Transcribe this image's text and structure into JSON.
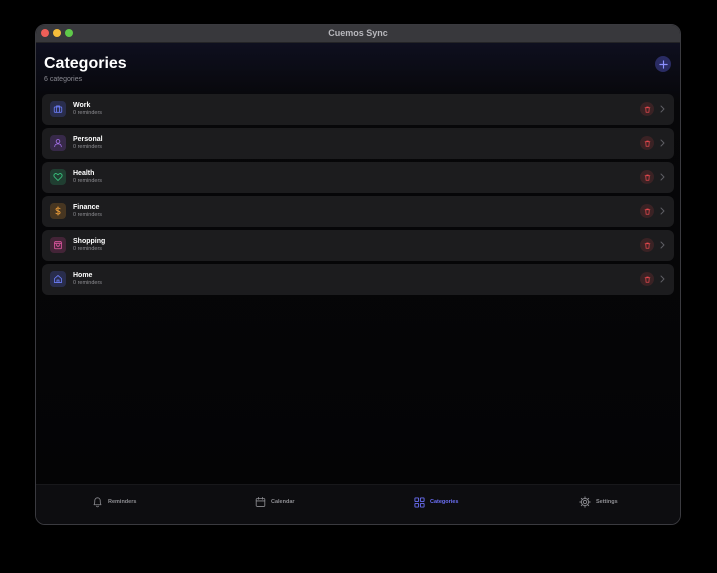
{
  "window": {
    "title": "Cuemos Sync"
  },
  "header": {
    "title": "Categories",
    "subtitle": "6 categories"
  },
  "colors": {
    "accent": "#6b6ff5",
    "delete": "#e5484d"
  },
  "categories": [
    {
      "name": "Work",
      "count": "0 reminders",
      "icon": "briefcase-icon",
      "color": "#5b6ff0"
    },
    {
      "name": "Personal",
      "count": "0 reminders",
      "icon": "person-icon",
      "color": "#9b5de5"
    },
    {
      "name": "Health",
      "count": "0 reminders",
      "icon": "heart-icon",
      "color": "#34c77b"
    },
    {
      "name": "Finance",
      "count": "0 reminders",
      "icon": "dollar-icon",
      "color": "#f59e2c"
    },
    {
      "name": "Shopping",
      "count": "0 reminders",
      "icon": "shopping-bag-icon",
      "color": "#e0489a"
    },
    {
      "name": "Home",
      "count": "0 reminders",
      "icon": "house-icon",
      "color": "#5b6ff0"
    }
  ],
  "tabs": [
    {
      "label": "Reminders",
      "icon": "bell-icon",
      "active": false
    },
    {
      "label": "Calendar",
      "icon": "calendar-icon",
      "active": false
    },
    {
      "label": "Categories",
      "icon": "grid-icon",
      "active": true
    },
    {
      "label": "Settings",
      "icon": "gear-icon",
      "active": false
    }
  ]
}
